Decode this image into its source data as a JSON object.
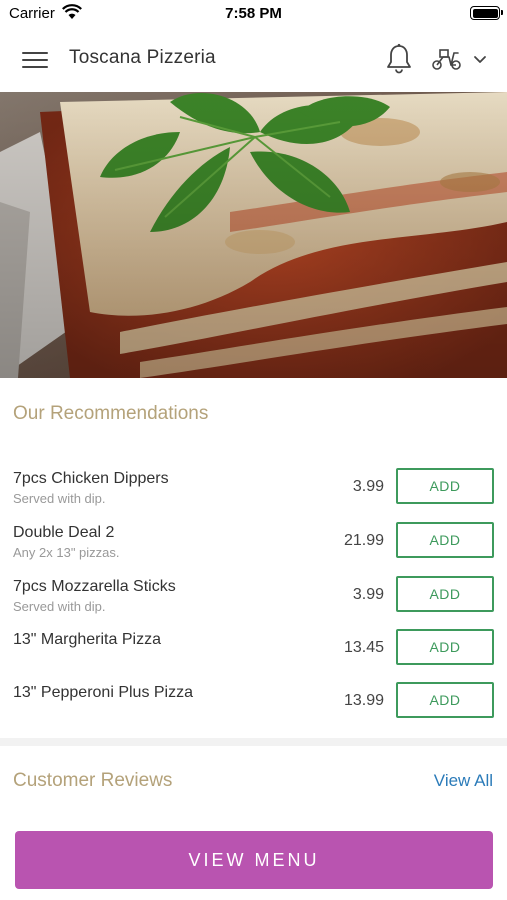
{
  "status_bar": {
    "carrier": "Carrier",
    "time": "7:58 PM"
  },
  "header": {
    "title": "Toscana Pizzeria",
    "icons": [
      "menu-icon",
      "bell-icon",
      "scooter-icon",
      "chevron-down-icon"
    ]
  },
  "hero": {
    "image": "lasagna-photo"
  },
  "recommendations": {
    "title": "Our Recommendations",
    "items": [
      {
        "name": "7pcs Chicken Dippers",
        "description": "Served with dip.",
        "price": "3.99",
        "button": "ADD"
      },
      {
        "name": "Double Deal 2",
        "description": "Any 2x 13\" pizzas.",
        "price": "21.99",
        "button": "ADD"
      },
      {
        "name": "7pcs Mozzarella Sticks",
        "description": "Served with dip.",
        "price": "3.99",
        "button": "ADD"
      },
      {
        "name": "13\" Margherita Pizza",
        "description": "",
        "price": "13.45",
        "button": "ADD"
      },
      {
        "name": "13\" Pepperoni Plus Pizza",
        "description": "",
        "price": "13.99",
        "button": "ADD"
      }
    ]
  },
  "reviews": {
    "title": "Customer Reviews",
    "view_all": "View All"
  },
  "footer": {
    "view_menu": "VIEW MENU"
  },
  "colors": {
    "accent_gold": "#b4a27a",
    "add_green": "#3d9a5c",
    "link_blue": "#2b7bb9",
    "primary_purple": "#b954b0"
  }
}
